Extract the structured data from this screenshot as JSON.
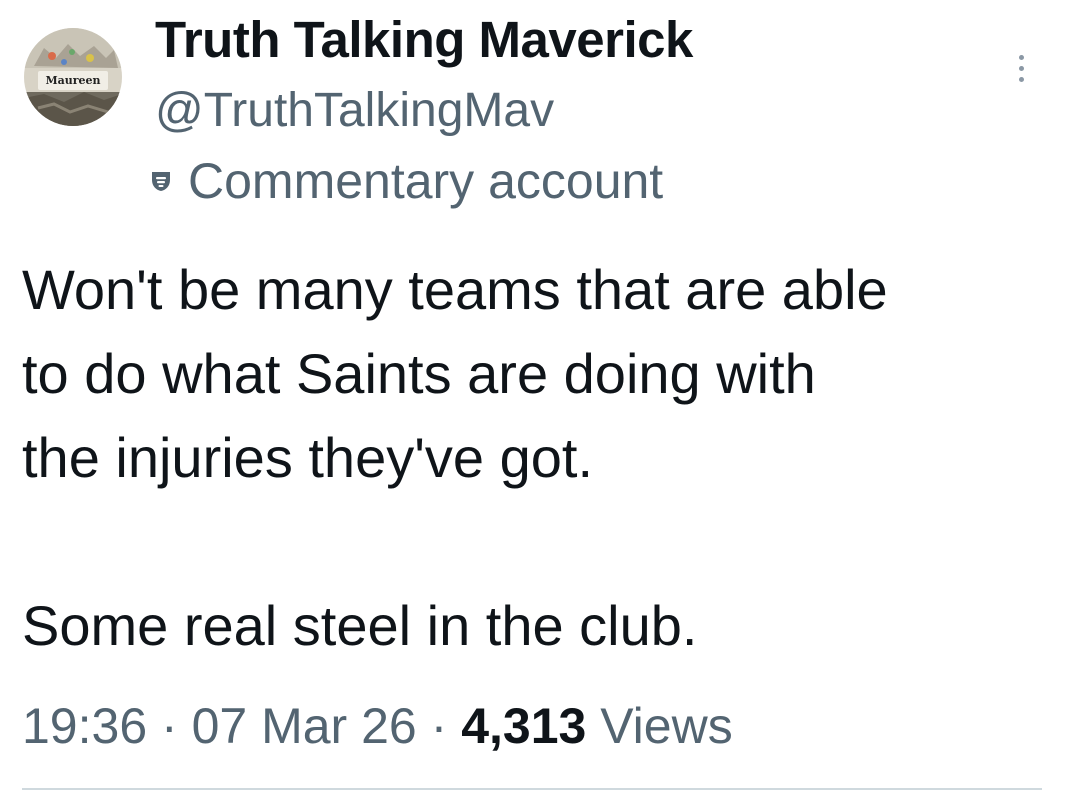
{
  "author": {
    "display_name": "Truth Talking Maverick",
    "handle": "@TruthTalkingMav",
    "badge_label": "Commentary account",
    "badge_icon": "theater-mask-icon",
    "avatar_label": "Maureen"
  },
  "tweet": {
    "paragraphs": [
      "Won't be many teams that are able\nto do what Saints are doing with\nthe injuries they've got.",
      "Some real steel in the club."
    ]
  },
  "meta": {
    "time": "19:36",
    "separator": "·",
    "date": "07 Mar 26",
    "views_count": "4,313",
    "views_label": "Views"
  },
  "colors": {
    "primary_text": "#0f1419",
    "secondary_text": "#536471",
    "divider": "#cfd9de"
  }
}
